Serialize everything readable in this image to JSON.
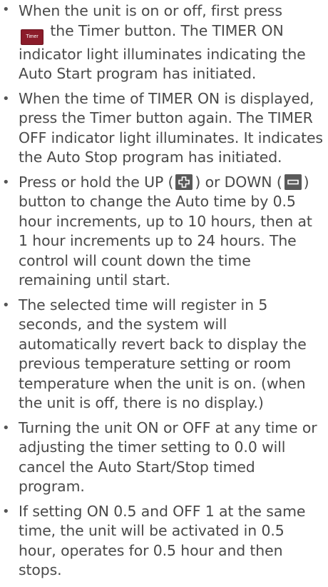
{
  "bullets": [
    {
      "text_before": "When the unit is on or off, first press",
      "button_label": "Timer",
      "text_after": " the Timer button. The TIMER ON indicator light illuminates indicating the Auto Start program has initiated."
    },
    {
      "text": "When the time of TIMER ON is displayed, press the Timer button again. The TIMER OFF indicator light illuminates. It indicates the Auto Stop program has initiated."
    },
    {
      "text_part1": "Press or hold the UP (",
      "up_icon": "plus-icon",
      "text_part2": ") or DOWN (",
      "down_icon": "minus-icon",
      "text_part3": ") button to change the Auto time by 0.5 hour increments, up to 10 hours, then at 1 hour increments up to 24 hours. The control will count down the time remaining until start."
    },
    {
      "text": "The selected time will register in 5 seconds, and the system will automatically revert back to display the previous temperature setting or room temperature when the unit is on. (when the unit is off, there is no display.)"
    },
    {
      "text": "Turning the unit ON or OFF at any time or adjusting the timer setting to 0.0 will cancel the Auto Start/Stop timed program."
    },
    {
      "text": "If setting ON 0.5 and OFF 1 at the same time, the unit will be activated in 0.5 hour, operates for 0.5 hour and then stops."
    }
  ],
  "bullet_glyph": "•",
  "colors": {
    "text": "#4a4a4a",
    "timer_button": "#8b1c2a",
    "icon_button": "#5a5a5a"
  }
}
